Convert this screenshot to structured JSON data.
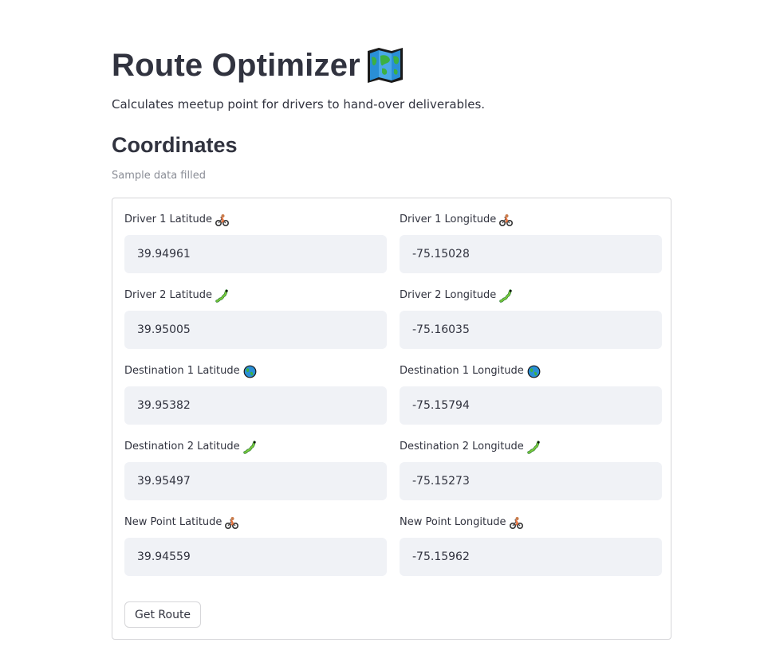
{
  "header": {
    "title": "Route Optimizer",
    "title_icon": "world-map-icon",
    "subtitle": "Calculates meetup point for drivers to hand-over deliverables."
  },
  "section": {
    "heading": "Coordinates",
    "caption": "Sample data filled"
  },
  "fields": [
    {
      "label": "Driver 1 Latitude",
      "icon": "cyclist-icon",
      "value": "39.94961"
    },
    {
      "label": "Driver 1 Longitude",
      "icon": "cyclist-icon",
      "value": "-75.15028"
    },
    {
      "label": "Driver 2 Latitude",
      "icon": "caterpillar-icon",
      "value": "39.95005"
    },
    {
      "label": "Driver 2 Longitude",
      "icon": "caterpillar-icon",
      "value": "-75.16035"
    },
    {
      "label": "Destination 1 Latitude",
      "icon": "globe-icon",
      "value": "39.95382"
    },
    {
      "label": "Destination 1 Longitude",
      "icon": "globe-icon",
      "value": "-75.15794"
    },
    {
      "label": "Destination 2 Latitude",
      "icon": "caterpillar-icon",
      "value": "39.95497"
    },
    {
      "label": "Destination 2 Longitude",
      "icon": "caterpillar-icon",
      "value": "-75.15273"
    },
    {
      "label": "New Point Latitude",
      "icon": "cyclist-icon",
      "value": "39.94559"
    },
    {
      "label": "New Point Longitude",
      "icon": "cyclist-icon",
      "value": "-75.15962"
    }
  ],
  "submit": {
    "label": "Get Route"
  },
  "colors": {
    "text": "#31333f",
    "input_bg": "#f0f2f6",
    "border": "#d6d6d9",
    "caption": "#8a8d96"
  }
}
